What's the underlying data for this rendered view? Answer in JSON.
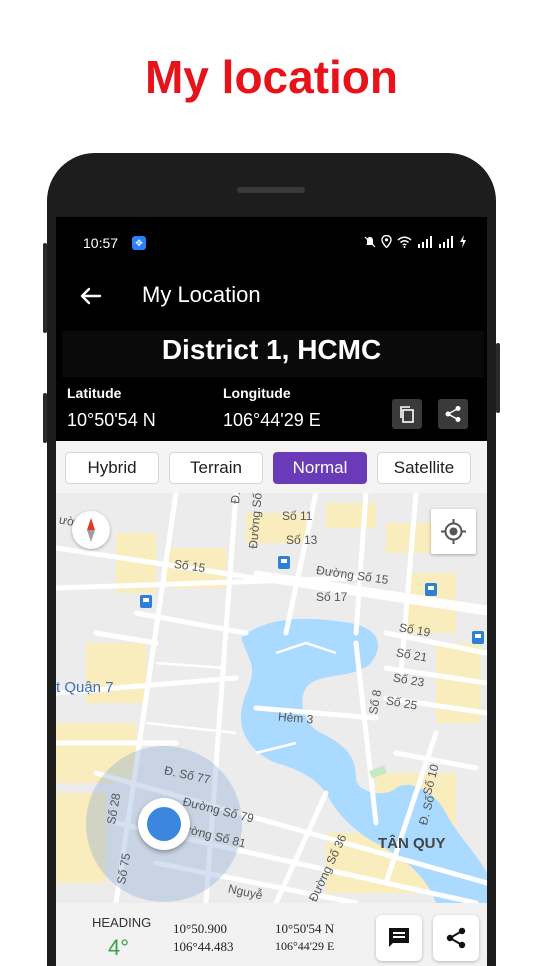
{
  "promo": {
    "title": "My location"
  },
  "status_bar": {
    "time": "10:57"
  },
  "app_bar": {
    "title": "My Location"
  },
  "location": {
    "district": "District 1, HCMC",
    "latitude_label": "Latitude",
    "latitude_value": "10°50'54 N",
    "longitude_label": "Longitude",
    "longitude_value": "106°44'29 E"
  },
  "map_types": {
    "tabs": [
      "Hybrid",
      "Terrain",
      "Normal",
      "Satellite"
    ],
    "selected": "Normal"
  },
  "map": {
    "labels": {
      "s11": "Số 11",
      "s13": "Số 13",
      "s15": "Số 15",
      "s17": "Số 17",
      "duong_so_15": "Đường Số 15",
      "s19": "Số 19",
      "s21": "Số 21",
      "s23": "Số 23",
      "s25": "Số 25",
      "s8": "Số 8",
      "s10": "Số 10",
      "hem3": "Hẻm 3",
      "quan7": "t Quận 7",
      "d_so_77": "Đ. Số 77",
      "duong_so_79": "Đường Số 79",
      "duong_so_81": "Đường Số 81",
      "s28": "Số 28",
      "s75": "Số 75",
      "duong_so_36": "Đường Số 36",
      "tan_quy": "TÂN QUY",
      "duong_so_vertical": "Đường Số",
      "d_so_small": "Đ. Số",
      "d_so_small2": "Đ. Số",
      "nguyen": "Nguyễ",
      "duong_left": "ường",
      "s15_left": "Số 15"
    },
    "colors": {
      "background": "#ececec",
      "road": "#ffffff",
      "block": "#faedbd",
      "water": "#aadaff",
      "accuracy_circle": "#7b9fd1",
      "location_dot": "#3d86e0"
    }
  },
  "bottom_bar": {
    "heading_label": "HEADING",
    "heading_value": "4°",
    "lat_decimal": "10°50.900",
    "lon_decimal": "106°44.483",
    "lat_dms": "10°50'54 N",
    "lon_dms": "106°44'29 E"
  }
}
